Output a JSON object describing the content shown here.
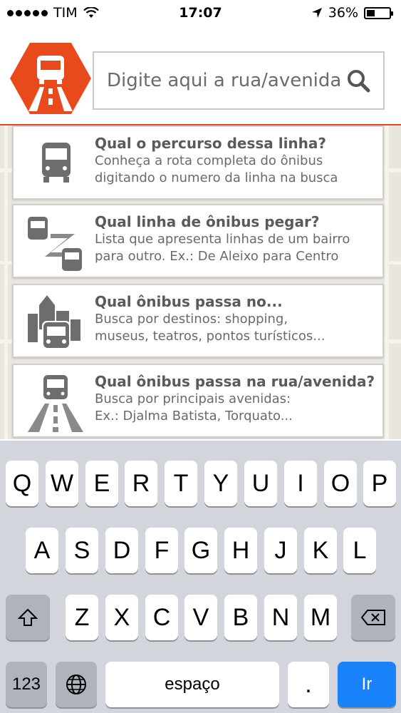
{
  "status": {
    "carrier": "TIM",
    "time": "17:07",
    "battery": "36%",
    "battery_level": 0.36
  },
  "search": {
    "placeholder": "Digite aqui a rua/avenida"
  },
  "colors": {
    "brand": "#e84a1c",
    "icon_gray": "#6d6d6d",
    "go_key": "#1a82fb"
  },
  "cards": [
    {
      "title": "Qual o percurso dessa linha?",
      "desc1": "Conheça a rota completa do ônibus",
      "desc2": "digitando o numero da linha na busca",
      "icon": "bus-icon"
    },
    {
      "title": "Qual linha de ônibus pegar?",
      "desc1": "Lista que apresenta linhas de um bairro",
      "desc2": "para outro. Ex.: De Aleixo para Centro",
      "icon": "bus-route-icon"
    },
    {
      "title": "Qual ônibus passa no...",
      "desc1": "Busca por destinos: shopping,",
      "desc2": "museus, teatros, pontos turísticos...",
      "icon": "city-bus-icon"
    },
    {
      "title": "Qual ônibus passa na rua/avenida?",
      "desc1": "Busca por principais avenidas:",
      "desc2": "Ex.: Djalma Batista, Torquato...",
      "icon": "bus-road-icon"
    }
  ],
  "keyboard": {
    "row1": [
      "Q",
      "W",
      "E",
      "R",
      "T",
      "Y",
      "U",
      "I",
      "O",
      "P"
    ],
    "row2": [
      "A",
      "S",
      "D",
      "F",
      "G",
      "H",
      "J",
      "K",
      "L"
    ],
    "row3": [
      "Z",
      "X",
      "C",
      "V",
      "B",
      "N",
      "M"
    ],
    "numbers": "123",
    "space": "espaço",
    "period": ".",
    "go": "Ir"
  }
}
